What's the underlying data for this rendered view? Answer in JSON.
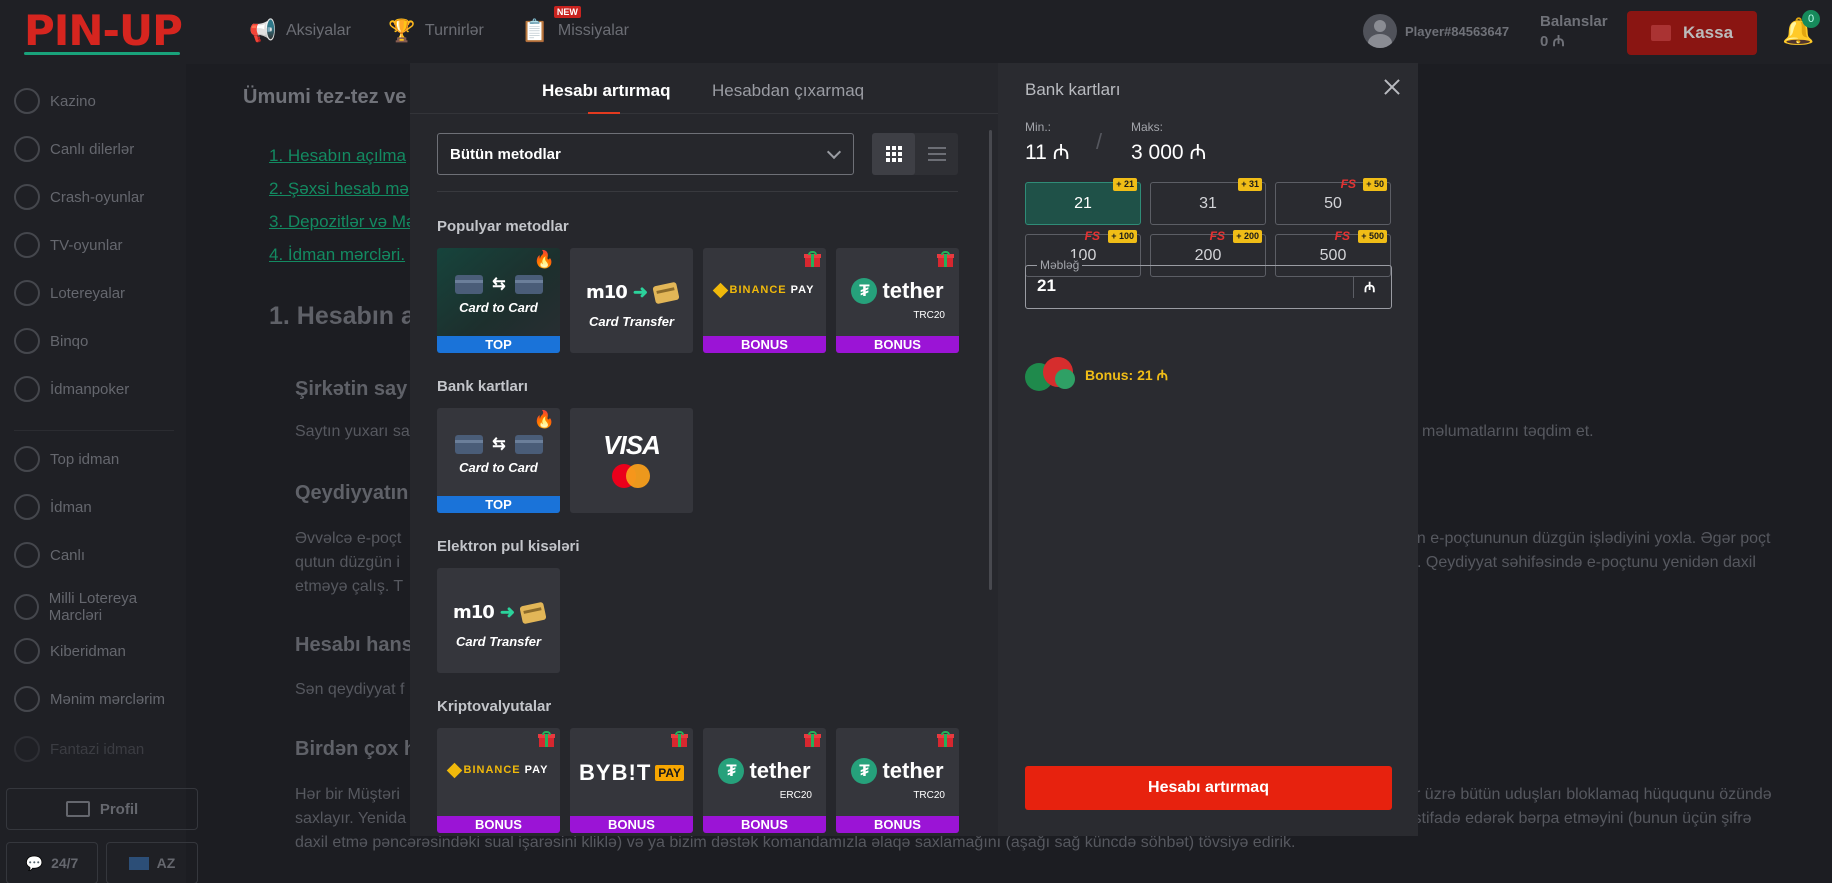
{
  "header": {
    "logo": "PIN-UP",
    "nav": [
      {
        "label": "Aksiyalar",
        "icon": "megaphone-icon"
      },
      {
        "label": "Turnirlər",
        "icon": "trophy-icon"
      },
      {
        "label": "Missiyalar",
        "icon": "missions-icon",
        "badge": "NEW"
      }
    ],
    "user": {
      "name": "Player#84563647"
    },
    "balance": {
      "label": "Balanslar",
      "value": "0 ₼"
    },
    "kassa_label": "Kassa",
    "notifications_count": "0"
  },
  "sidebar": {
    "items": [
      {
        "label": "Kazino"
      },
      {
        "label": "Canlı dilerlər"
      },
      {
        "label": "Crash-oyunlar"
      },
      {
        "label": "TV-oyunlar"
      },
      {
        "label": "Lotereyalar"
      },
      {
        "label": "Binqo"
      },
      {
        "label": "İdmanpoker"
      },
      {
        "label": "Top idman"
      },
      {
        "label": "İdman"
      },
      {
        "label": "Canlı"
      },
      {
        "label": "Milli Lotereya Marcləri"
      },
      {
        "label": "Kiberidman"
      },
      {
        "label": "Mənim mərclərim"
      },
      {
        "label": "Fantazi idman"
      }
    ],
    "profile_label": "Profil",
    "support_label": "24/7",
    "lang_label": "AZ"
  },
  "article": {
    "title": "Ümumi tez-tez ve",
    "links": [
      "1. Hesabın açılma",
      "2. Şəxsi hesab mə",
      "3. Depozitlər və Mə",
      "4. İdman mərcləri."
    ],
    "h2": "1. Hesabın a",
    "h3a": "Şirkətin say",
    "p1": "Saytın yuxarı sa",
    "p1_right": "l məlumatlarını təqdim et.",
    "h3b": "Qeydiyyatın",
    "p2_l1": "Əvvəlcə e-poçt",
    "p2_l2": "qutun düzgün i",
    "p2_l3": "etməyə çalış. T",
    "p2_r1": "ün e-poçtununun düzgün işlədiyini yoxla. Əgər poçt",
    "p2_r2": ". Qeydiyyat səhifəsində e-poçtunu yenidən daxil",
    "h3c": "Hesabı hans",
    "p3": "Sən qeydiyyat f",
    "h3d": "Birdən çox h",
    "p4_l1": "Hər bir Müştəri",
    "p4_l2": "saxlayır. Yenida",
    "p4_r1": "r üzrə bütün uduşları bloklamaq hüququnu özündə",
    "p4_r2": "istifadə edərək bərpa etməyini (bunun üçün şifrə",
    "p4_l3": "daxil etmə pəncərəsindəki sual işarəsini kliklə) və ya bizim dəstək komandamızla əlaqə saxlamağını (aşağı sağ küncdə söhbət) tövsiyə edirik."
  },
  "modal": {
    "tabs": {
      "deposit": "Hesabı artırmaq",
      "withdraw": "Hesabdan çıxarmaq"
    },
    "methods_select": "Bütün metodlar",
    "sections": {
      "popular": "Populyar metodlar",
      "bank": "Bank kartları",
      "ewallet": "Elektron pul kisələri",
      "crypto": "Kriptovalyutalar"
    },
    "cards": {
      "card_to_card": "Card to Card",
      "card_transfer": "Card Transfer",
      "m10": "m10",
      "binance": "BINANCE",
      "binance_pay": "PAY",
      "tether": "tether",
      "trc20": "TRC20",
      "erc20": "ERC20",
      "visa": "VISA",
      "bybit": "BYB!T",
      "bybit_pay": "PAY",
      "top_label": "TOP",
      "bonus_label": "BONUS"
    },
    "right": {
      "title": "Bank kartları",
      "min_label": "Min.:",
      "min_value": "11 ₼",
      "max_label": "Maks:",
      "max_value": "3 000 ₼",
      "amounts": [
        {
          "value": "21",
          "bonus": "+ 21",
          "fs": false
        },
        {
          "value": "31",
          "bonus": "+ 31",
          "fs": false
        },
        {
          "value": "50",
          "bonus": "+ 50",
          "fs": true
        },
        {
          "value": "100",
          "bonus": "+ 100",
          "fs": true
        },
        {
          "value": "200",
          "bonus": "+ 200",
          "fs": true
        },
        {
          "value": "500",
          "bonus": "+ 500",
          "fs": true
        }
      ],
      "fs_label": "FS",
      "amount_label": "Məbləğ",
      "amount_value": "21",
      "currency": "₼",
      "bonus_text": "Bonus: 21 ₼",
      "submit": "Hesabı artırmaq"
    }
  }
}
